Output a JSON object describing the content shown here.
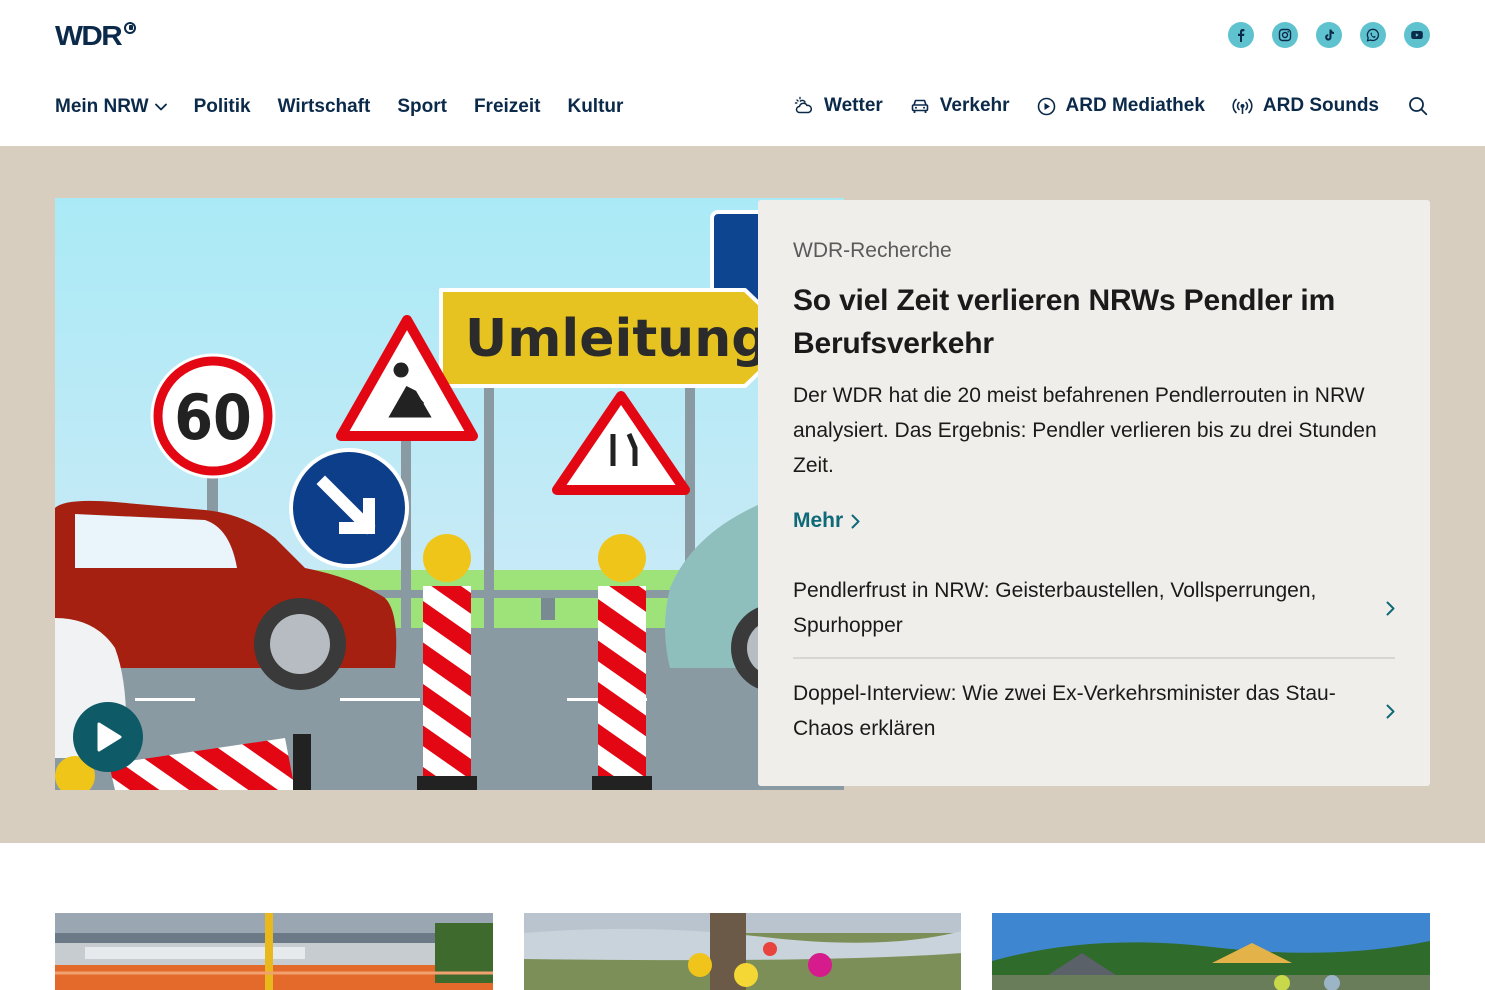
{
  "brand": {
    "logo_text": "WDR"
  },
  "social": [
    {
      "name": "facebook-icon"
    },
    {
      "name": "instagram-icon"
    },
    {
      "name": "tiktok-icon"
    },
    {
      "name": "whatsapp-icon"
    },
    {
      "name": "youtube-icon"
    }
  ],
  "nav": {
    "main": [
      "Mein NRW",
      "Politik",
      "Wirtschaft",
      "Sport",
      "Freizeit",
      "Kultur"
    ],
    "services": [
      "Wetter",
      "Verkehr",
      "ARD Mediathek",
      "ARD Sounds"
    ]
  },
  "hero": {
    "image_sign_text": "Umleitung",
    "speed_limit": "60",
    "kicker": "WDR-Recherche",
    "headline": "So viel Zeit verlieren NRWs Pendler im Berufsverkehr",
    "teaser": "Der WDR hat die 20 meist befahrenen Pendlerrouten in NRW analysiert. Das Ergebnis: Pendler verlieren bis zu drei Stunden Zeit.",
    "more_label": "Mehr",
    "related": [
      "Pendlerfrust in NRW: Geisterbaustellen, Vollsperrungen, Spurhopper",
      "Doppel-Interview: Wie zwei Ex-Verkehrsminister das Stau-Chaos erklären"
    ]
  },
  "colors": {
    "navy": "#0b2a4a",
    "teal": "#0e6a79",
    "social_bg": "#5fc2cf",
    "hero_bg": "#d8cebf",
    "card_bg": "#f0eeea"
  }
}
